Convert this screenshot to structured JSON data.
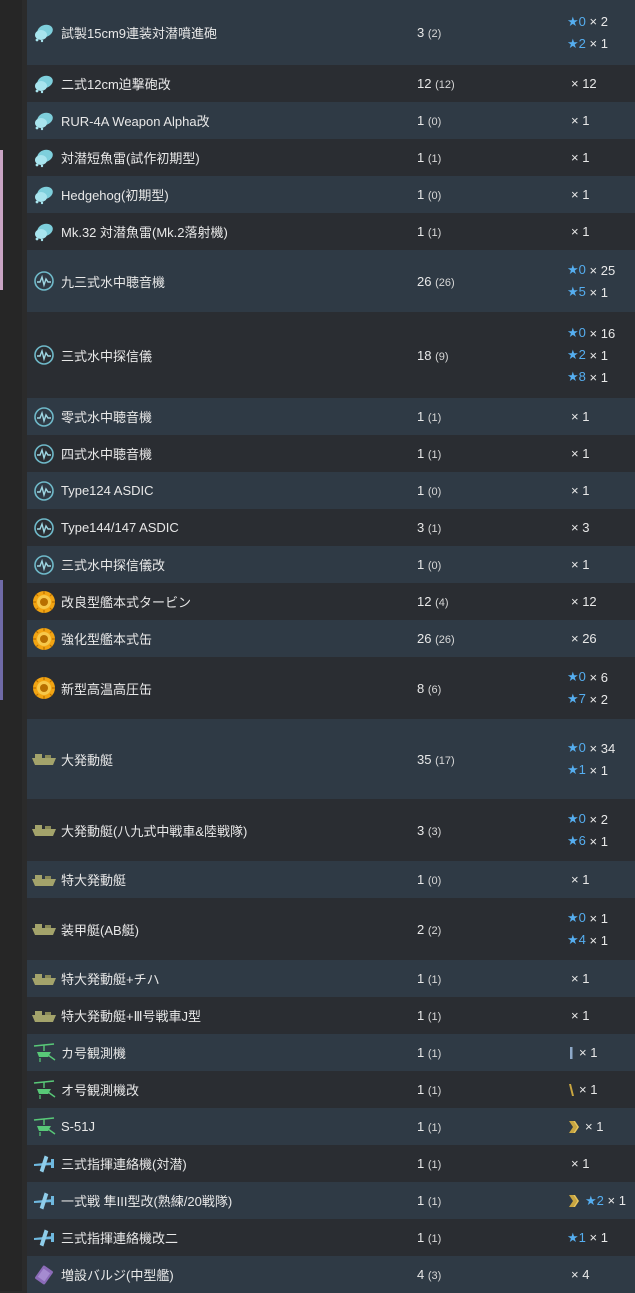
{
  "colors": {
    "row_odd": "#2f3a45",
    "row_even": "#2a2d32",
    "star": "#55aef0",
    "asw_icon": "#7ecfdc",
    "sonar_icon": "#6fb9c9",
    "engine_icon": "#f2a412",
    "landing_craft_icon": "#a3a36b",
    "autogyro_icon": "#58c978",
    "liaison_plane_icon": "#6fb9e0",
    "bulge_icon": "#8b6bb8",
    "proficiency_gold": "#c9a640",
    "proficiency_blue": "#8ea9c9"
  },
  "equipment": [
    {
      "icon": "depth-charge-icon",
      "name": "試製15cm9連装対潜噴進砲",
      "count": "3",
      "sub": "(2)",
      "improvements": [
        {
          "prof": "",
          "star": "★0",
          "qty": "× 2"
        },
        {
          "prof": "",
          "star": "★2",
          "qty": "× 1"
        }
      ]
    },
    {
      "icon": "depth-charge-icon",
      "name": "二式12cm迫撃砲改",
      "count": "12",
      "sub": "(12)",
      "improvements": [
        {
          "prof": "",
          "star": "",
          "qty": "× 12"
        }
      ]
    },
    {
      "icon": "depth-charge-icon",
      "name": "RUR-4A Weapon Alpha改",
      "count": "1",
      "sub": "(0)",
      "improvements": [
        {
          "prof": "",
          "star": "",
          "qty": "× 1"
        }
      ]
    },
    {
      "icon": "depth-charge-icon",
      "name": "対潜短魚雷(試作初期型)",
      "count": "1",
      "sub": "(1)",
      "improvements": [
        {
          "prof": "",
          "star": "",
          "qty": "× 1"
        }
      ]
    },
    {
      "icon": "depth-charge-icon",
      "name": "Hedgehog(初期型)",
      "count": "1",
      "sub": "(0)",
      "improvements": [
        {
          "prof": "",
          "star": "",
          "qty": "× 1"
        }
      ]
    },
    {
      "icon": "depth-charge-icon",
      "name": "Mk.32 対潜魚雷(Mk.2落射機)",
      "count": "1",
      "sub": "(1)",
      "improvements": [
        {
          "prof": "",
          "star": "",
          "qty": "× 1"
        }
      ]
    },
    {
      "icon": "sonar-icon",
      "name": "九三式水中聴音機",
      "count": "26",
      "sub": "(26)",
      "improvements": [
        {
          "prof": "",
          "star": "★0",
          "qty": "× 25"
        },
        {
          "prof": "",
          "star": "★5",
          "qty": "× 1"
        }
      ]
    },
    {
      "icon": "sonar-icon",
      "name": "三式水中探信儀",
      "count": "18",
      "sub": "(9)",
      "improvements": [
        {
          "prof": "",
          "star": "★0",
          "qty": "× 16"
        },
        {
          "prof": "",
          "star": "★2",
          "qty": "× 1"
        },
        {
          "prof": "",
          "star": "★8",
          "qty": "× 1"
        }
      ]
    },
    {
      "icon": "sonar-icon",
      "name": "零式水中聴音機",
      "count": "1",
      "sub": "(1)",
      "improvements": [
        {
          "prof": "",
          "star": "",
          "qty": "× 1"
        }
      ]
    },
    {
      "icon": "sonar-icon",
      "name": "四式水中聴音機",
      "count": "1",
      "sub": "(1)",
      "improvements": [
        {
          "prof": "",
          "star": "",
          "qty": "× 1"
        }
      ]
    },
    {
      "icon": "sonar-icon",
      "name": "Type124 ASDIC",
      "count": "1",
      "sub": "(0)",
      "improvements": [
        {
          "prof": "",
          "star": "",
          "qty": "× 1"
        }
      ]
    },
    {
      "icon": "sonar-icon",
      "name": "Type144/147 ASDIC",
      "count": "3",
      "sub": "(1)",
      "improvements": [
        {
          "prof": "",
          "star": "",
          "qty": "× 3"
        }
      ]
    },
    {
      "icon": "sonar-icon",
      "name": "三式水中探信儀改",
      "count": "1",
      "sub": "(0)",
      "improvements": [
        {
          "prof": "",
          "star": "",
          "qty": "× 1"
        }
      ]
    },
    {
      "icon": "engine-icon",
      "name": "改良型艦本式タービン",
      "count": "12",
      "sub": "(4)",
      "improvements": [
        {
          "prof": "",
          "star": "",
          "qty": "× 12"
        }
      ]
    },
    {
      "icon": "engine-icon",
      "name": "強化型艦本式缶",
      "count": "26",
      "sub": "(26)",
      "improvements": [
        {
          "prof": "",
          "star": "",
          "qty": "× 26"
        }
      ]
    },
    {
      "icon": "engine-icon",
      "name": "新型高温高圧缶",
      "count": "8",
      "sub": "(6)",
      "improvements": [
        {
          "prof": "",
          "star": "★0",
          "qty": "× 6"
        },
        {
          "prof": "",
          "star": "★7",
          "qty": "× 2"
        }
      ]
    },
    {
      "icon": "landing-craft-icon",
      "name": "大発動艇",
      "count": "35",
      "sub": "(17)",
      "improvements": [
        {
          "prof": "",
          "star": "★0",
          "qty": "× 34"
        },
        {
          "prof": "",
          "star": "★1",
          "qty": "× 1"
        }
      ]
    },
    {
      "icon": "landing-craft-icon",
      "name": "大発動艇(八九式中戦車&陸戦隊)",
      "count": "3",
      "sub": "(3)",
      "improvements": [
        {
          "prof": "",
          "star": "★0",
          "qty": "× 2"
        },
        {
          "prof": "",
          "star": "★6",
          "qty": "× 1"
        }
      ]
    },
    {
      "icon": "landing-craft-icon",
      "name": "特大発動艇",
      "count": "1",
      "sub": "(0)",
      "improvements": [
        {
          "prof": "",
          "star": "",
          "qty": "× 1"
        }
      ]
    },
    {
      "icon": "landing-craft-icon",
      "name": "装甲艇(AB艇)",
      "count": "2",
      "sub": "(2)",
      "improvements": [
        {
          "prof": "",
          "star": "★0",
          "qty": "× 1"
        },
        {
          "prof": "",
          "star": "★4",
          "qty": "× 1"
        }
      ]
    },
    {
      "icon": "landing-craft-icon",
      "name": "特大発動艇+チハ",
      "count": "1",
      "sub": "(1)",
      "improvements": [
        {
          "prof": "",
          "star": "",
          "qty": "× 1"
        }
      ]
    },
    {
      "icon": "landing-craft-icon",
      "name": "特大発動艇+Ⅲ号戦車J型",
      "count": "1",
      "sub": "(1)",
      "improvements": [
        {
          "prof": "",
          "star": "",
          "qty": "× 1"
        }
      ]
    },
    {
      "icon": "autogyro-icon",
      "name": "カ号観測機",
      "count": "1",
      "sub": "(1)",
      "improvements": [
        {
          "prof": "proficiency-1-icon",
          "star": "",
          "qty": "× 1"
        }
      ]
    },
    {
      "icon": "autogyro-icon",
      "name": "オ号観測機改",
      "count": "1",
      "sub": "(1)",
      "improvements": [
        {
          "prof": "proficiency-2-icon",
          "star": "",
          "qty": "× 1"
        }
      ]
    },
    {
      "icon": "autogyro-icon",
      "name": "S-51J",
      "count": "1",
      "sub": "(1)",
      "improvements": [
        {
          "prof": "proficiency-max-icon",
          "star": "",
          "qty": "× 1"
        }
      ]
    },
    {
      "icon": "liaison-plane-icon",
      "name": "三式指揮連絡機(対潜)",
      "count": "1",
      "sub": "(1)",
      "improvements": [
        {
          "prof": "",
          "star": "",
          "qty": "× 1"
        }
      ]
    },
    {
      "icon": "liaison-plane-icon",
      "name": "一式戦 隼III型改(熟練/20戦隊)",
      "count": "1",
      "sub": "(1)",
      "improvements": [
        {
          "prof": "proficiency-max-icon",
          "star": "★2",
          "qty": "× 1"
        }
      ]
    },
    {
      "icon": "liaison-plane-icon",
      "name": "三式指揮連絡機改二",
      "count": "1",
      "sub": "(1)",
      "improvements": [
        {
          "prof": "",
          "star": "★1",
          "qty": "× 1"
        }
      ]
    },
    {
      "icon": "bulge-icon",
      "name": "増設バルジ(中型艦)",
      "count": "4",
      "sub": "(3)",
      "improvements": [
        {
          "prof": "",
          "star": "",
          "qty": "× 4"
        }
      ]
    }
  ]
}
